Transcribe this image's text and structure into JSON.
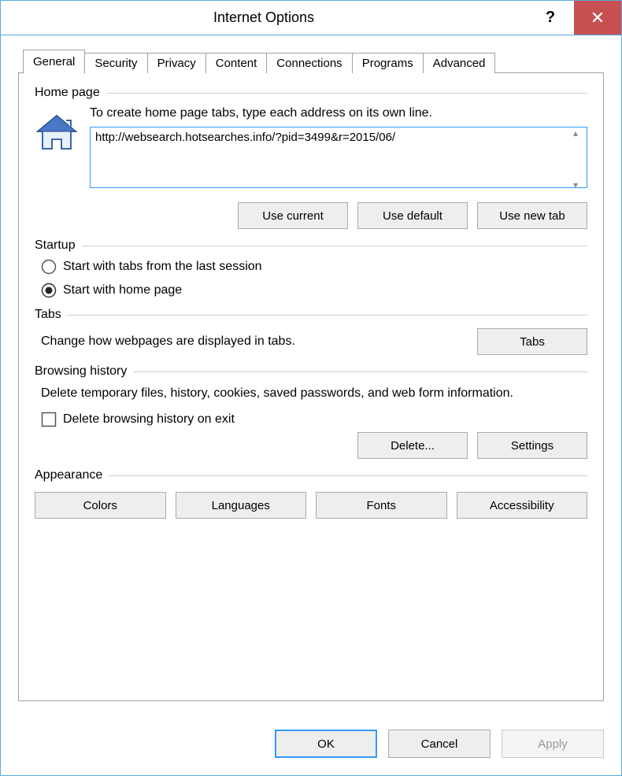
{
  "window": {
    "title": "Internet Options",
    "help": "?",
    "close": "✕"
  },
  "tabs": {
    "items": [
      {
        "label": "General"
      },
      {
        "label": "Security"
      },
      {
        "label": "Privacy"
      },
      {
        "label": "Content"
      },
      {
        "label": "Connections"
      },
      {
        "label": "Programs"
      },
      {
        "label": "Advanced"
      }
    ]
  },
  "home": {
    "group_label": "Home page",
    "desc": "To create home page tabs, type each address on its own line.",
    "value": "http://websearch.hotsearches.info/?pid=3499&r=2015/06/",
    "btn_current": "Use current",
    "btn_default": "Use default",
    "btn_newtab": "Use new tab"
  },
  "startup": {
    "group_label": "Startup",
    "opt_last": "Start with tabs from the last session",
    "opt_home": "Start with home page"
  },
  "tabssec": {
    "group_label": "Tabs",
    "desc": "Change how webpages are displayed in tabs.",
    "btn": "Tabs"
  },
  "history": {
    "group_label": "Browsing history",
    "desc": "Delete temporary files, history, cookies, saved passwords, and web form information.",
    "check_label": "Delete browsing history on exit",
    "btn_delete": "Delete...",
    "btn_settings": "Settings"
  },
  "appearance": {
    "group_label": "Appearance",
    "btn_colors": "Colors",
    "btn_languages": "Languages",
    "btn_fonts": "Fonts",
    "btn_access": "Accessibility"
  },
  "footer": {
    "ok": "OK",
    "cancel": "Cancel",
    "apply": "Apply"
  }
}
